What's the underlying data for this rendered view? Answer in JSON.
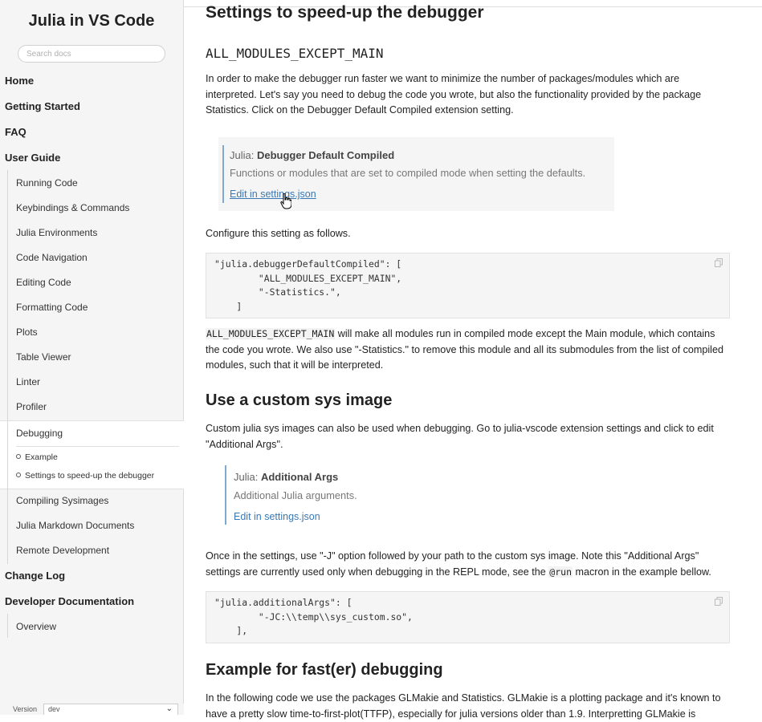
{
  "sidebar": {
    "title": "Julia in VS Code",
    "search_placeholder": "Search docs",
    "home": "Home",
    "getting_started": "Getting Started",
    "faq": "FAQ",
    "user_guide": "User Guide",
    "user_guide_items": [
      "Running Code",
      "Keybindings & Commands",
      "Julia Environments",
      "Code Navigation",
      "Editing Code",
      "Formatting Code",
      "Plots",
      "Table Viewer",
      "Linter",
      "Profiler"
    ],
    "active_item": "Debugging",
    "toc": [
      "Example",
      "Settings to speed-up the debugger"
    ],
    "after_items": [
      "Compiling Sysimages",
      "Julia Markdown Documents",
      "Remote Development"
    ],
    "change_log": "Change Log",
    "developer_docs": "Developer Documentation",
    "developer_items": [
      "Overview"
    ],
    "version_label": "Version",
    "version_value": "dev"
  },
  "main": {
    "heading_speedup": "Settings to speed-up the debugger",
    "heading_all_modules": "ALL_MODULES_EXCEPT_MAIN",
    "para1": "In order to make the debugger run faster we want to minimize the number of packages/modules which are interpreted. Let's say you need to debug the code you wrote, but also the functionality provided by the package Statistics. Click on the Debugger Default Compiled extension setting.",
    "setting1": {
      "prefix": "Julia: ",
      "name": "Debugger Default Compiled",
      "description": "Functions or modules that are set to compiled mode when setting the defaults.",
      "link": "Edit in settings.json"
    },
    "para2": "Configure this setting as follows.",
    "code1": "\"julia.debuggerDefaultCompiled\": [\n        \"ALL_MODULES_EXCEPT_MAIN\",\n        \"-Statistics.\",\n    ]",
    "para3_code": "ALL_MODULES_EXCEPT_MAIN",
    "para3_text": " will make all modules run in compiled mode except the Main module, which contains the code you wrote. We also use \"-Statistics.\" to remove this module and all its submodules from the list of compiled modules, such that it will be interpreted.",
    "heading_custom": "Use a custom sys image",
    "para4": "Custom julia sys images can also be used when debugging. Go to julia-vscode extension settings and click to edit \"Additional Args\".",
    "setting2": {
      "prefix": "Julia: ",
      "name": "Additional Args",
      "description": "Additional Julia arguments.",
      "link": "Edit in settings.json"
    },
    "para5_a": "Once in the settings, use \"-J\" option followed by your path to the custom sys image. Note this \"Additional Args\" settings are currently used only when debugging in the REPL mode, see the ",
    "para5_code": "@run",
    "para5_b": " macron in the example bellow.",
    "code2": "\"julia.additionalArgs\": [\n        \"-JC:\\\\temp\\\\sys_custom.so\",\n    ],",
    "heading_example": "Example for fast(er) debugging",
    "para6": "In the following code we use the packages GLMakie and Statistics. GLMakie is a plotting package and it's known to have a pretty slow time-to-first-plot(TTFP), especially for julia versions older than 1.9. Interpretting GLMakie is"
  }
}
